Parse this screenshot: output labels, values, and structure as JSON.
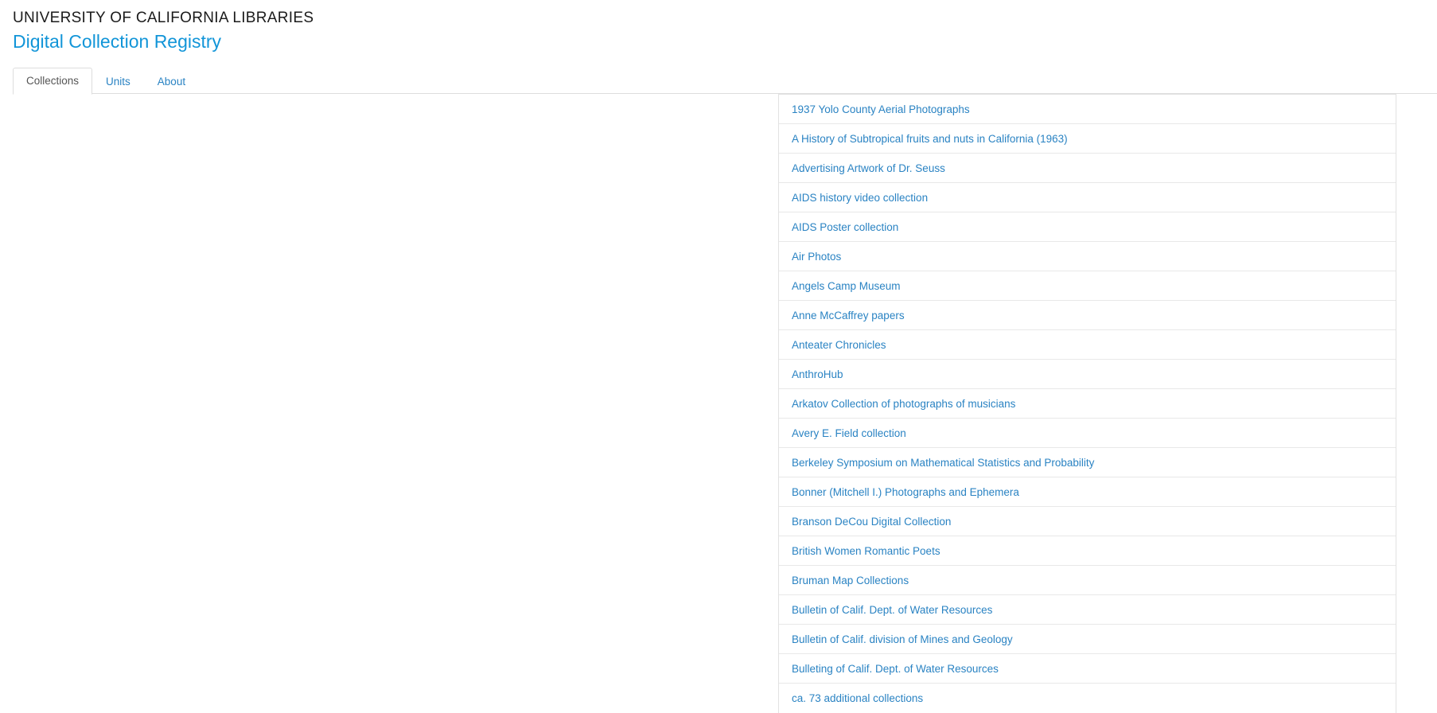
{
  "masthead": {
    "org_title": "UNIVERSITY OF CALIFORNIA LIBRARIES",
    "site_title": "Digital Collection Registry"
  },
  "colors": {
    "brand_blue": "#1295d8",
    "link_blue": "#2a83c3",
    "tab_active_text": "#555555",
    "border_grey": "#dddddd",
    "row_divider": "#e8e8e8"
  },
  "tabs": [
    {
      "label": "Collections",
      "active": true
    },
    {
      "label": "Units",
      "active": false
    },
    {
      "label": "About",
      "active": false
    }
  ],
  "collections": [
    {
      "label": "1937 Yolo County Aerial Photographs"
    },
    {
      "label": "A History of Subtropical fruits and nuts in California (1963)"
    },
    {
      "label": "Advertising Artwork of Dr. Seuss"
    },
    {
      "label": "AIDS history video collection"
    },
    {
      "label": "AIDS Poster collection"
    },
    {
      "label": "Air Photos"
    },
    {
      "label": "Angels Camp Museum"
    },
    {
      "label": "Anne McCaffrey papers"
    },
    {
      "label": "Anteater Chronicles"
    },
    {
      "label": "AnthroHub"
    },
    {
      "label": "Arkatov Collection of photographs of musicians"
    },
    {
      "label": "Avery E. Field collection"
    },
    {
      "label": "Berkeley Symposium on Mathematical Statistics and Probability"
    },
    {
      "label": "Bonner (Mitchell I.) Photographs and Ephemera"
    },
    {
      "label": "Branson DeCou Digital Collection"
    },
    {
      "label": "British Women Romantic Poets"
    },
    {
      "label": "Bruman Map Collections"
    },
    {
      "label": "Bulletin of Calif. Dept. of Water Resources"
    },
    {
      "label": "Bulletin of Calif. division of Mines and Geology"
    },
    {
      "label": "Bulleting of Calif. Dept. of Water Resources"
    },
    {
      "label": "ca. 73 additional collections"
    }
  ]
}
